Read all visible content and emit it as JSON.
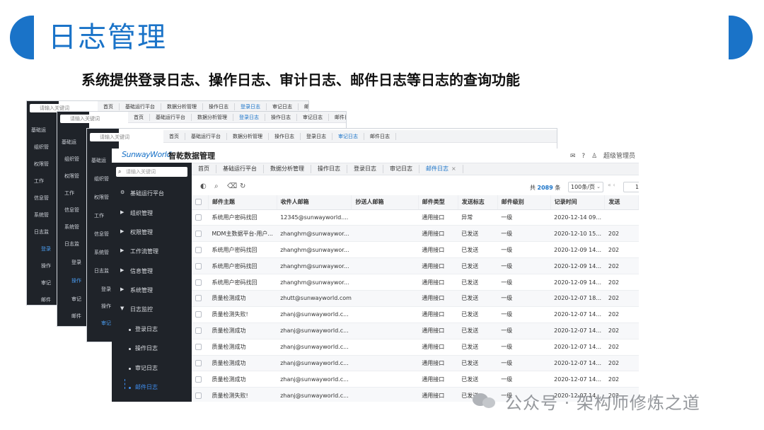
{
  "slide": {
    "title": "日志管理",
    "subtitle": "系统提供登录日志、操作日志、审计日志、邮件日志等日志的查询功能"
  },
  "back_cards": {
    "search_placeholder": "请输入关键词",
    "tabs": [
      "首页",
      "基础运行平台",
      "数据分析管理",
      "操作日志",
      "登录日志",
      "审记日志",
      "邮件日志"
    ],
    "nav_fragments": [
      "基础运",
      "组织管",
      "权限管",
      "工作",
      "信息管",
      "系统管",
      "日志监",
      "登录",
      "操作",
      "审记",
      "邮件"
    ]
  },
  "app": {
    "logo": "SunwayWorld",
    "name": "智乾数据管理",
    "header_icons": [
      "mail-icon",
      "help-icon",
      "user-icon"
    ],
    "user_label": "超级管理员"
  },
  "sidebar": {
    "search_placeholder": "请输入关键词",
    "items": [
      {
        "label": "基础运行平台",
        "kind": "group",
        "icon": "platform-icon"
      },
      {
        "label": "组织管理",
        "kind": "collapsed"
      },
      {
        "label": "权限管理",
        "kind": "collapsed"
      },
      {
        "label": "工作流管理",
        "kind": "collapsed"
      },
      {
        "label": "信息管理",
        "kind": "collapsed"
      },
      {
        "label": "系统管理",
        "kind": "collapsed"
      },
      {
        "label": "日志监控",
        "kind": "expanded"
      },
      {
        "label": "登录日志",
        "kind": "sub"
      },
      {
        "label": "操作日志",
        "kind": "sub"
      },
      {
        "label": "审记日志",
        "kind": "sub"
      },
      {
        "label": "邮件日志",
        "kind": "sub-active"
      }
    ]
  },
  "tabs": [
    {
      "label": "首页",
      "active": false
    },
    {
      "label": "基础运行平台",
      "active": false
    },
    {
      "label": "数据分析管理",
      "active": false
    },
    {
      "label": "操作日志",
      "active": false
    },
    {
      "label": "登录日志",
      "active": false
    },
    {
      "label": "审记日志",
      "active": false
    },
    {
      "label": "邮件日志",
      "active": true
    }
  ],
  "toolbar": {
    "total_prefix": "共",
    "total_count": "2089",
    "total_suffix": "条",
    "page_size": "100条/页",
    "page_current": "1"
  },
  "table": {
    "columns": [
      "邮件主题",
      "收件人邮箱",
      "抄送人邮箱",
      "邮件类型",
      "发送标志",
      "邮件级别",
      "记录时间",
      "发送"
    ],
    "rows": [
      [
        "系统用户密码找回",
        "12345@sunwayworld....",
        "",
        "通用接口",
        "异常",
        "一级",
        "2020-12-14 09...",
        ""
      ],
      [
        "MDM主数据平台-用户...",
        "zhanghm@sunwaywor...",
        "",
        "通用接口",
        "已发送",
        "一级",
        "2020-12-10 15...",
        "202"
      ],
      [
        "系统用户密码找回",
        "zhanghm@sunwaywor...",
        "",
        "通用接口",
        "已发送",
        "一级",
        "2020-12-09 14...",
        "202"
      ],
      [
        "系统用户密码找回",
        "zhanghm@sunwaywor...",
        "",
        "通用接口",
        "已发送",
        "一级",
        "2020-12-09 14...",
        "202"
      ],
      [
        "系统用户密码找回",
        "zhanghm@sunwaywor...",
        "",
        "通用接口",
        "已发送",
        "一级",
        "2020-12-09 14...",
        "202"
      ],
      [
        "质量检测成功",
        "zhutt@sunwayworld.com",
        "",
        "通用接口",
        "已发送",
        "一级",
        "2020-12-07 18...",
        "202"
      ],
      [
        "质量检测失败!",
        "zhanj@sunwayworld.c...",
        "",
        "通用接口",
        "已发送",
        "一级",
        "2020-12-07 14...",
        "202"
      ],
      [
        "质量检测成功",
        "zhanj@sunwayworld.c...",
        "",
        "通用接口",
        "已发送",
        "一级",
        "2020-12-07 14...",
        "202"
      ],
      [
        "质量检测成功",
        "zhanj@sunwayworld.c...",
        "",
        "通用接口",
        "已发送",
        "一级",
        "2020-12-07 14...",
        "202"
      ],
      [
        "质量检测成功",
        "zhanj@sunwayworld.c...",
        "",
        "通用接口",
        "已发送",
        "一级",
        "2020-12-07 14...",
        "202"
      ],
      [
        "质量检测成功",
        "zhanj@sunwayworld.c...",
        "",
        "通用接口",
        "已发送",
        "一级",
        "2020-12-07 14...",
        "202"
      ],
      [
        "质量检测失败!",
        "zhanj@sunwayworld.c...",
        "",
        "通用接口",
        "已发送",
        "一级",
        "2020-12-07 14...",
        "202"
      ]
    ]
  },
  "watermark": "公众号 · 架构师修炼之道",
  "colors": {
    "accent": "#1a73c8",
    "sidebar": "#1f2329",
    "active_nav": "#3f8ef0"
  }
}
